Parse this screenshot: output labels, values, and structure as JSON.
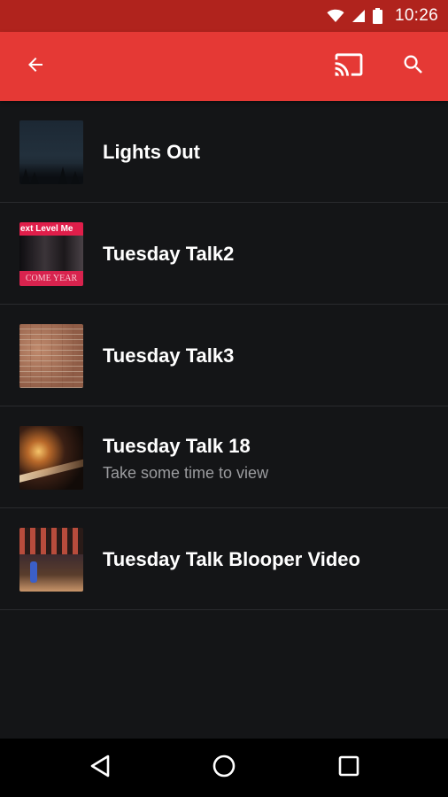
{
  "status_bar": {
    "time": "10:26",
    "icons": [
      "wifi-icon",
      "cell-signal-icon",
      "battery-icon"
    ]
  },
  "app_bar": {
    "color": "#e53935",
    "status_color": "#b0231d",
    "icons": [
      "back-arrow-icon",
      "cast-icon",
      "search-icon"
    ]
  },
  "videos": [
    {
      "title": "Lights Out",
      "subtitle": ""
    },
    {
      "title": "Tuesday Talk2",
      "subtitle": "",
      "thumbnail_text": {
        "top": "ext Level Me",
        "bottom": "COME YEAR"
      }
    },
    {
      "title": "Tuesday Talk3",
      "subtitle": ""
    },
    {
      "title": "Tuesday Talk 18",
      "subtitle": "Take some time to view"
    },
    {
      "title": "Tuesday Talk Blooper Video",
      "subtitle": ""
    }
  ],
  "nav_bar": {
    "icons": [
      "nav-back-icon",
      "nav-home-icon",
      "nav-recents-icon"
    ]
  }
}
